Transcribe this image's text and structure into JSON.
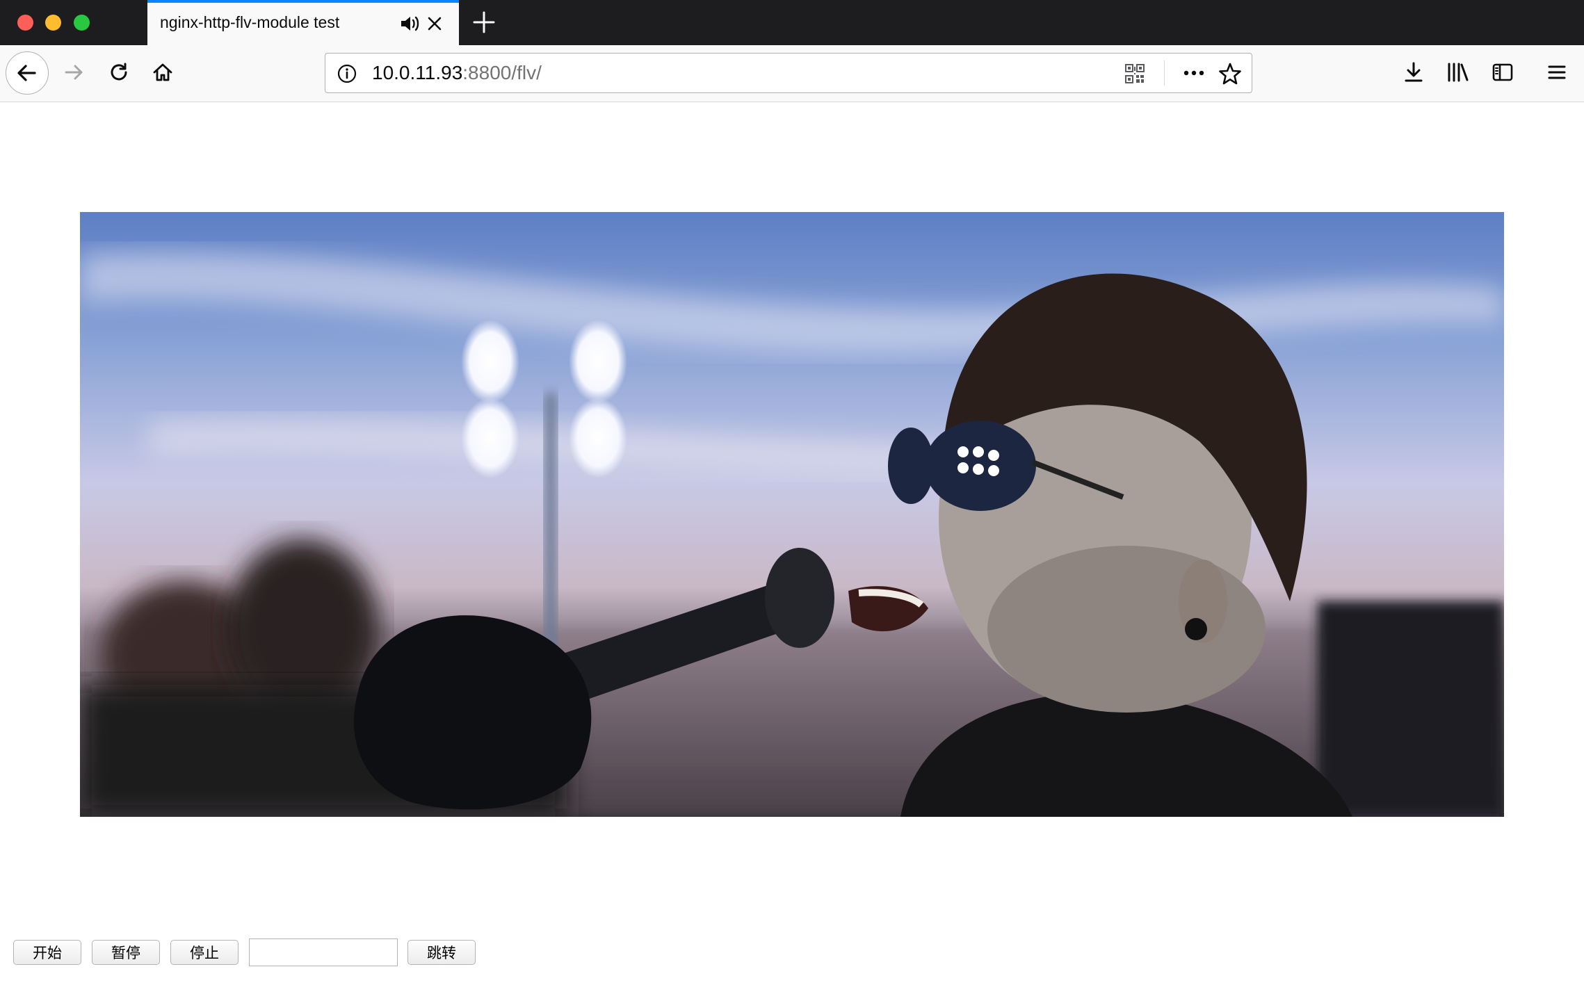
{
  "tab": {
    "title": "nginx-http-flv-module test"
  },
  "urlbar": {
    "host": "10.0.11.93",
    "rest": ":8800/flv/"
  },
  "icons": {
    "back": "back-arrow-icon",
    "forward": "forward-arrow-icon",
    "reload": "reload-icon",
    "home": "home-icon",
    "info": "info-icon",
    "qr": "qr-code-icon",
    "more": "more-dots-icon",
    "bookmark": "star-icon",
    "downloads": "download-icon",
    "library": "library-icon",
    "sidebar": "sidebar-icon",
    "menu": "hamburger-menu-icon",
    "audio": "speaker-icon",
    "close": "close-icon",
    "newtab": "plus-icon"
  },
  "colors": {
    "accent": "#0a84ff",
    "tabstrip": "#1d1d1f",
    "toolbar": "#f9f9fa"
  },
  "controls": {
    "start_label": "开始",
    "pause_label": "暂停",
    "stop_label": "停止",
    "seek_value": "",
    "jump_label": "跳转"
  }
}
